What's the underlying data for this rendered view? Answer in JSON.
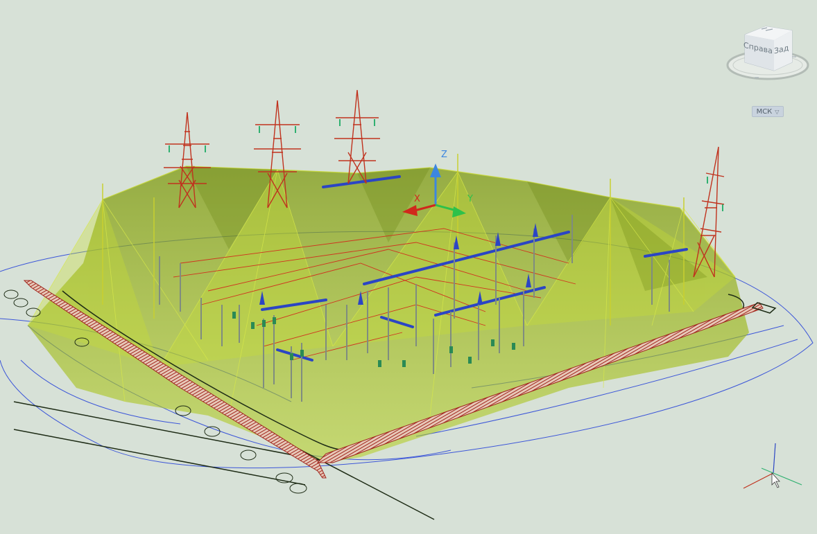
{
  "viewcube": {
    "face_right": "Справа",
    "face_back": "Зад"
  },
  "ucs_menu": {
    "label": "МСК",
    "caret": "▽"
  },
  "gizmo": {
    "z_label": "Z",
    "x_label": "X",
    "y_label": "Y"
  },
  "colors": {
    "background": "#d7e1d7",
    "zone_fill": "#a7c41a",
    "fence": "#a0251c",
    "busbar": "#2b45c4",
    "tower": "#c0321e",
    "boundary_lines": "#3b55d8"
  }
}
